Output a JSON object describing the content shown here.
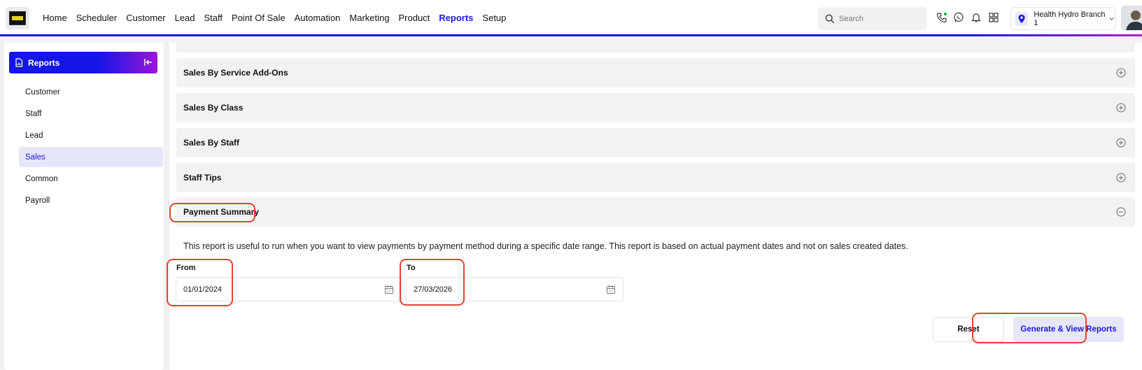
{
  "header": {
    "nav": [
      "Home",
      "Scheduler",
      "Customer",
      "Lead",
      "Staff",
      "Point Of Sale",
      "Automation",
      "Marketing",
      "Product",
      "Reports",
      "Setup"
    ],
    "active_nav": "Reports",
    "search_placeholder": "Search",
    "branch": "Health Hydro Branch 1"
  },
  "sidebar": {
    "title": "Reports",
    "items": [
      "Customer",
      "Staff",
      "Lead",
      "Sales",
      "Common",
      "Payroll"
    ],
    "active": "Sales"
  },
  "main": {
    "sections": [
      "Sales By Service Add-Ons",
      "Sales By Class",
      "Sales By Staff",
      "Staff Tips",
      "Payment Summary"
    ],
    "expanded_section": "Payment Summary",
    "description": "This report is useful to run when you want to view payments by payment method during a specific date range. This report is based on actual payment dates and not on sales created dates.",
    "from_label": "From",
    "from_value": "01/01/2024",
    "to_label": "To",
    "to_value": "27/03/2026",
    "reset_label": "Reset",
    "generate_label": "Generate & View Reports"
  },
  "colors": {
    "accent": "#1a1adf",
    "highlight": "#e0452f"
  },
  "icons": [
    "search-icon",
    "phone-icon",
    "whatsapp-icon",
    "bell-icon",
    "apps-grid-icon",
    "location-pin-icon",
    "chevron-down-icon",
    "report-icon",
    "collapse-icon",
    "plus-circle-icon",
    "minus-circle-icon",
    "calendar-icon"
  ]
}
